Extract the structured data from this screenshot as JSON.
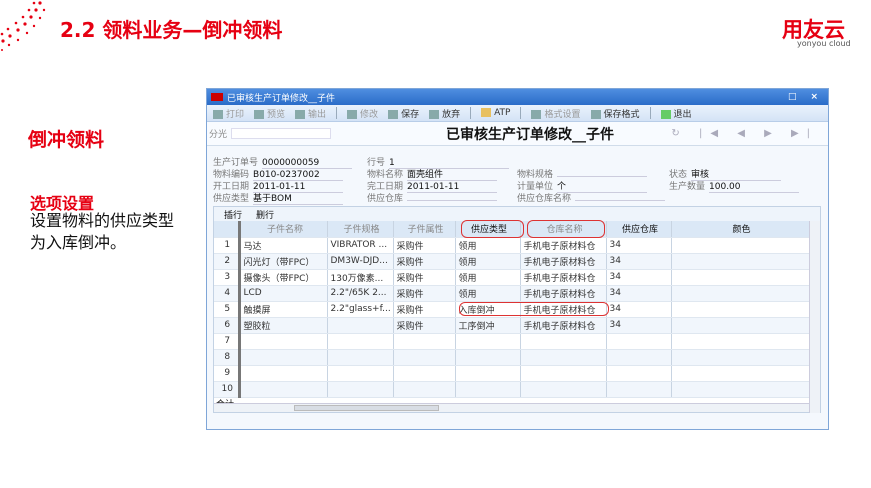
{
  "slide": {
    "title": "2.2 领料业务—倒冲领料",
    "logo": "用友云",
    "logo_sub": "yonyou cloud",
    "subtitle": "倒冲领料",
    "section": "选项设置",
    "description": "设置物料的供应类型为入库倒冲。"
  },
  "window": {
    "title": "已审核生产订单修改__子件",
    "controls": [
      "□",
      "×"
    ],
    "toolbar": [
      {
        "label": "打印",
        "enabled": false
      },
      {
        "label": "预览",
        "enabled": false
      },
      {
        "label": "输出",
        "enabled": false
      },
      {
        "label": "修改",
        "enabled": false
      },
      {
        "label": "保存",
        "enabled": true
      },
      {
        "label": "放弃",
        "enabled": true
      },
      {
        "label": "ATP",
        "enabled": true
      },
      {
        "label": "格式设置",
        "enabled": false
      },
      {
        "label": "保存格式",
        "enabled": true
      },
      {
        "label": "退出",
        "enabled": true
      }
    ],
    "filter_label": "分光",
    "heading": "已审核生产订单修改__子件",
    "nav": "↻ |◀ ◀ ▶ ▶|",
    "fields": {
      "order_no_l": "生产订单号",
      "order_no": "0000000059",
      "line_l": "行号",
      "line": "1",
      "code_l": "物料编码",
      "code": "B010-0237002",
      "name_l": "物料名称",
      "name": "面壳组件",
      "spec_l": "物料规格",
      "spec": "",
      "status_l": "状态",
      "status": "审核",
      "start_l": "开工日期",
      "start": "2011-01-11",
      "end_l": "完工日期",
      "end": "2011-01-11",
      "unit_l": "计量单位",
      "unit": "个",
      "qty_l": "生产数量",
      "qty": "100.00",
      "stype_l": "供应类型",
      "stype": "基于BOM",
      "swh_l": "供应仓库",
      "swh": "",
      "swhn_l": "供应仓库名称",
      "swhn": ""
    },
    "tabs": [
      "插行",
      "删行"
    ],
    "columns": [
      "子件名称",
      "子件规格",
      "子件属性",
      "供应类型",
      "仓库名称",
      "供应仓库",
      "颜色"
    ],
    "rows": [
      [
        "1",
        "马达",
        "VIBRATOR ...",
        "采购件",
        "领用",
        "手机电子原材料仓",
        "34",
        ""
      ],
      [
        "2",
        "闪光灯（带FPC）",
        "DM3W-DJD...",
        "采购件",
        "领用",
        "手机电子原材料仓",
        "34",
        ""
      ],
      [
        "3",
        "摄像头（带FPC）",
        "130万像素...",
        "采购件",
        "领用",
        "手机电子原材料仓",
        "34",
        ""
      ],
      [
        "4",
        "LCD",
        "2.2\"/65K 2...",
        "采购件",
        "领用",
        "手机电子原材料仓",
        "34",
        ""
      ],
      [
        "5",
        "触摸屏",
        "2.2\"glass+f...",
        "采购件",
        "入库倒冲",
        "手机电子原材料仓",
        "34",
        ""
      ],
      [
        "6",
        "塑胶粒",
        "",
        "采购件",
        "工序倒冲",
        "手机电子原材料仓",
        "34",
        ""
      ],
      [
        "7",
        "",
        "",
        "",
        "",
        "",
        "",
        ""
      ],
      [
        "8",
        "",
        "",
        "",
        "",
        "",
        "",
        ""
      ],
      [
        "9",
        "",
        "",
        "",
        "",
        "",
        "",
        ""
      ],
      [
        "10",
        "",
        "",
        "",
        "",
        "",
        "",
        ""
      ]
    ],
    "sum_label": "合计"
  }
}
